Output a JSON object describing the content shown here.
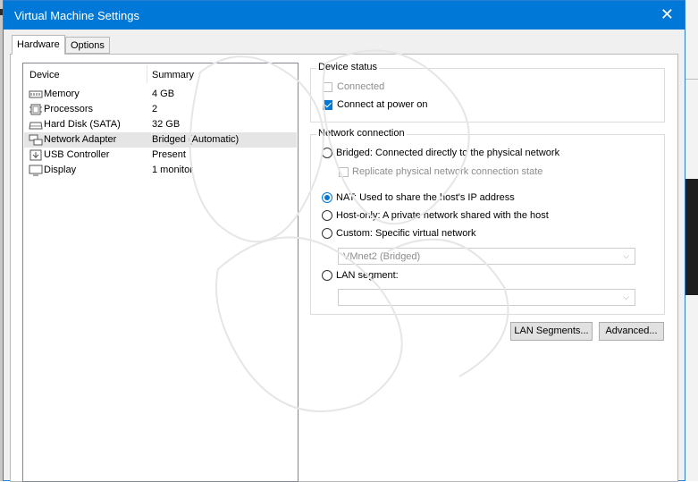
{
  "window": {
    "title": "Virtual Machine Settings"
  },
  "tabs": [
    {
      "label": "Hardware",
      "active": true
    },
    {
      "label": "Options",
      "active": false
    }
  ],
  "device_list": {
    "columns": {
      "device": "Device",
      "summary": "Summary"
    },
    "rows": [
      {
        "name": "Memory",
        "summary": "4 GB",
        "icon": "memory-icon"
      },
      {
        "name": "Processors",
        "summary": "2",
        "icon": "processor-icon"
      },
      {
        "name": "Hard Disk (SATA)",
        "summary": "32 GB",
        "icon": "hard-disk-icon"
      },
      {
        "name": "Network Adapter",
        "summary": "Bridged (Automatic)",
        "icon": "network-adapter-icon",
        "selected": true
      },
      {
        "name": "USB Controller",
        "summary": "Present",
        "icon": "usb-icon"
      },
      {
        "name": "Display",
        "summary": "1 monitor",
        "icon": "display-icon"
      }
    ]
  },
  "device_status": {
    "title": "Device status",
    "connected": {
      "label": "Connected",
      "checked": false,
      "disabled": true
    },
    "connect_at_power_on": {
      "label": "Connect at power on",
      "checked": true
    }
  },
  "network_connection": {
    "title": "Network connection",
    "bridged": "Bridged: Connected directly to the physical network",
    "replicate": "Replicate physical network connection state",
    "nat": "NAT: Used to share the host's IP address",
    "host_only": "Host-only: A private network shared with the host",
    "custom": "Custom: Specific virtual network",
    "custom_select": "VMnet2 (Bridged)",
    "lan_segment": "LAN segment:",
    "lan_select": "",
    "selected": "nat"
  },
  "buttons": {
    "lan_segments": "LAN Segments...",
    "advanced": "Advanced..."
  },
  "colors": {
    "accent": "#0078d7",
    "selection": "#e5e5e5"
  }
}
